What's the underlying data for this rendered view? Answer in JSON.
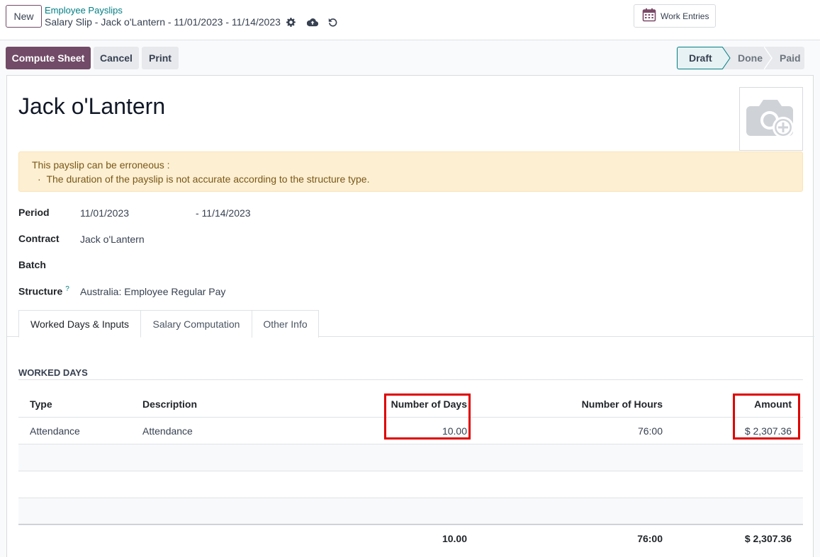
{
  "control_panel": {
    "new_label": "New",
    "breadcrumb_parent": "Employee Payslips",
    "breadcrumb_current": "Salary Slip - Jack o'Lantern - 11/01/2023 - 11/14/2023",
    "work_entries_label": "Work Entries"
  },
  "actions": {
    "compute_label": "Compute Sheet",
    "cancel_label": "Cancel",
    "print_label": "Print"
  },
  "status": {
    "stages": [
      "Draft",
      "Done",
      "Paid"
    ],
    "active": "Draft"
  },
  "sheet": {
    "employee_name": "Jack o'Lantern",
    "alert_title": "This payslip can be erroneous :",
    "alert_item": "The duration of the payslip is not accurate according to the structure type.",
    "fields": {
      "period_label": "Period",
      "period_from": "11/01/2023",
      "period_to": "- 11/14/2023",
      "contract_label": "Contract",
      "contract_value": "Jack o'Lantern",
      "batch_label": "Batch",
      "structure_label": "Structure",
      "structure_help": "?",
      "structure_value": "Australia: Employee Regular Pay"
    },
    "tabs": [
      "Worked Days & Inputs",
      "Salary Computation",
      "Other Info"
    ],
    "active_tab": "Worked Days & Inputs"
  },
  "worked_days": {
    "section_title": "WORKED DAYS",
    "columns": [
      "Type",
      "Description",
      "Number of Days",
      "Number of Hours",
      "Amount"
    ],
    "rows": [
      {
        "type": "Attendance",
        "description": "Attendance",
        "days": "10.00",
        "hours": "76:00",
        "amount": "$ 2,307.36"
      }
    ],
    "totals": {
      "days": "10.00",
      "hours": "76:00",
      "amount": "$ 2,307.36"
    }
  },
  "colors": {
    "primary": "#714b67",
    "link": "#017e84",
    "alert_bg": "#fcefd2",
    "highlight": "#e00000"
  }
}
